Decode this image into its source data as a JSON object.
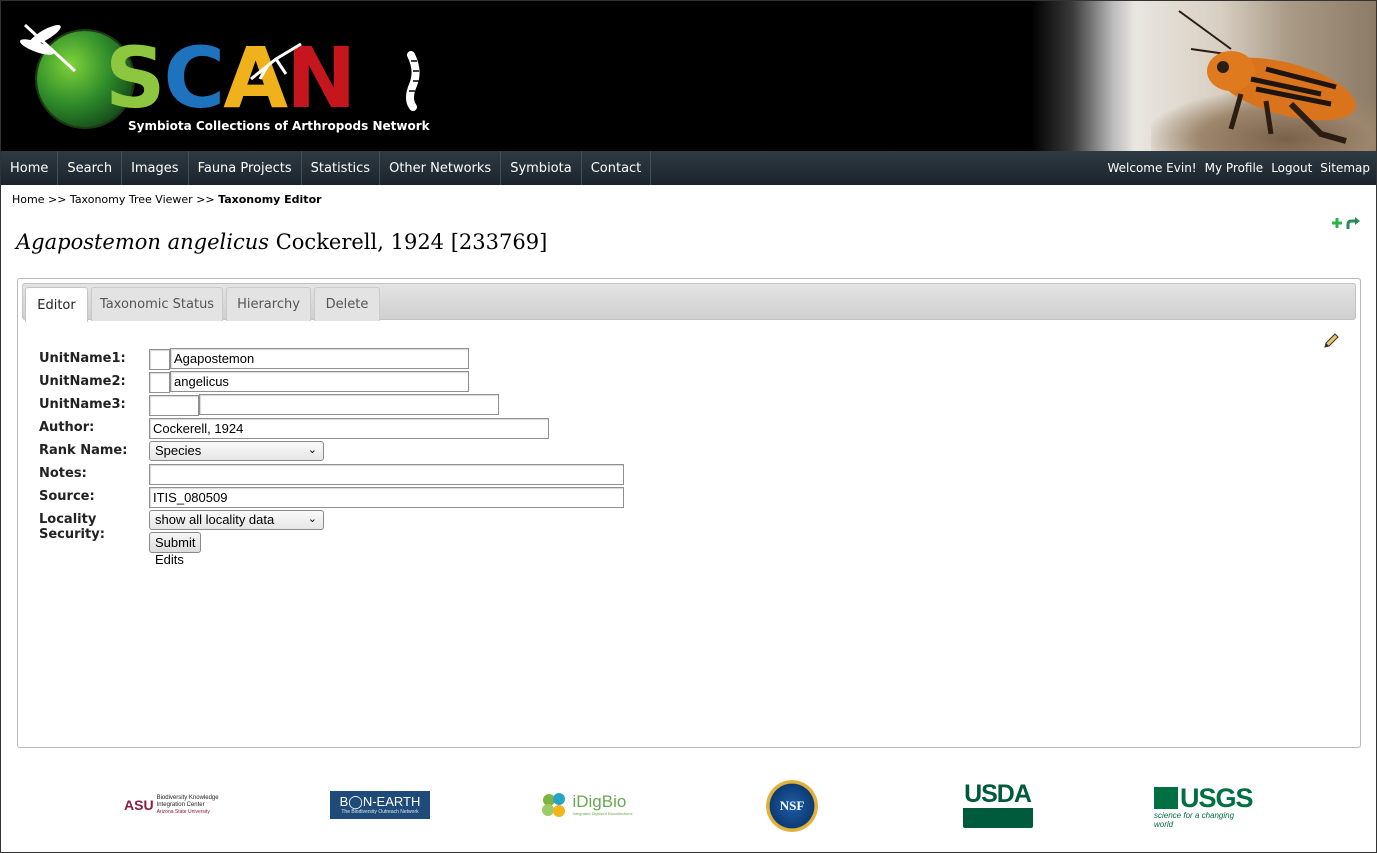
{
  "header": {
    "logo": {
      "letters": [
        "S",
        "C",
        "A",
        "N"
      ],
      "letter_colors": [
        "#8dc63f",
        "#1e73be",
        "#f0b21c",
        "#c4161c"
      ],
      "subtitle": "Symbiota Collections of Arthropods Network"
    }
  },
  "nav": {
    "items": [
      {
        "label": "Home"
      },
      {
        "label": "Search"
      },
      {
        "label": "Images"
      },
      {
        "label": "Fauna Projects"
      },
      {
        "label": "Statistics"
      },
      {
        "label": "Other Networks"
      },
      {
        "label": "Symbiota"
      },
      {
        "label": "Contact"
      }
    ],
    "welcome": "Welcome Evin!",
    "my_profile": "My Profile",
    "logout": "Logout",
    "sitemap": "Sitemap"
  },
  "breadcrumb": {
    "home": "Home",
    "sep": ">>",
    "tree": "Taxonomy Tree Viewer",
    "current": "Taxonomy Editor"
  },
  "taxon": {
    "sciname": "Agapostemon angelicus",
    "author": "Cockerell, 1924",
    "tid": "[233769]"
  },
  "tabs": [
    {
      "label": "Editor",
      "active": true
    },
    {
      "label": "Taxonomic Status",
      "active": false
    },
    {
      "label": "Hierarchy",
      "active": false
    },
    {
      "label": "Delete",
      "active": false
    }
  ],
  "form": {
    "unitname1": {
      "label": "UnitName1:",
      "ind": "",
      "value": "Agapostemon"
    },
    "unitname2": {
      "label": "UnitName2:",
      "ind": "",
      "value": "angelicus"
    },
    "unitname3": {
      "label": "UnitName3:",
      "ind": "",
      "value": ""
    },
    "author": {
      "label": "Author:",
      "value": "Cockerell, 1924"
    },
    "rank": {
      "label": "Rank Name:",
      "value": "Species"
    },
    "notes": {
      "label": "Notes:",
      "value": ""
    },
    "source": {
      "label": "Source:",
      "value": "ITIS_080509"
    },
    "locality": {
      "label_line1": "Locality",
      "label_line2": "Security:",
      "value": "show all locality data"
    },
    "submit": "Submit Edits"
  },
  "footer": {
    "asu_title": "Biodiversity Knowledge Integration Center",
    "asu_sub": "Arizona State University",
    "bonearth": "B◯N-EARTH",
    "bonearth_sub": "The Biodiversity Outreach Network",
    "idigbio": "iDigBio",
    "idigbio_sub": "Integrated Digitized Biocollections",
    "nsf": "NSF",
    "usda": "USDA",
    "usgs": "USGS",
    "usgs_sub": "science for a changing world"
  },
  "colors": {
    "nav_bg": "#1f2a33",
    "plus_icon": "#2db34a",
    "undo_icon": "#2a8a5a",
    "usda_green": "#005a3c",
    "usgs_green": "#006f41",
    "bonearth_blue": "#1e4b7a"
  }
}
